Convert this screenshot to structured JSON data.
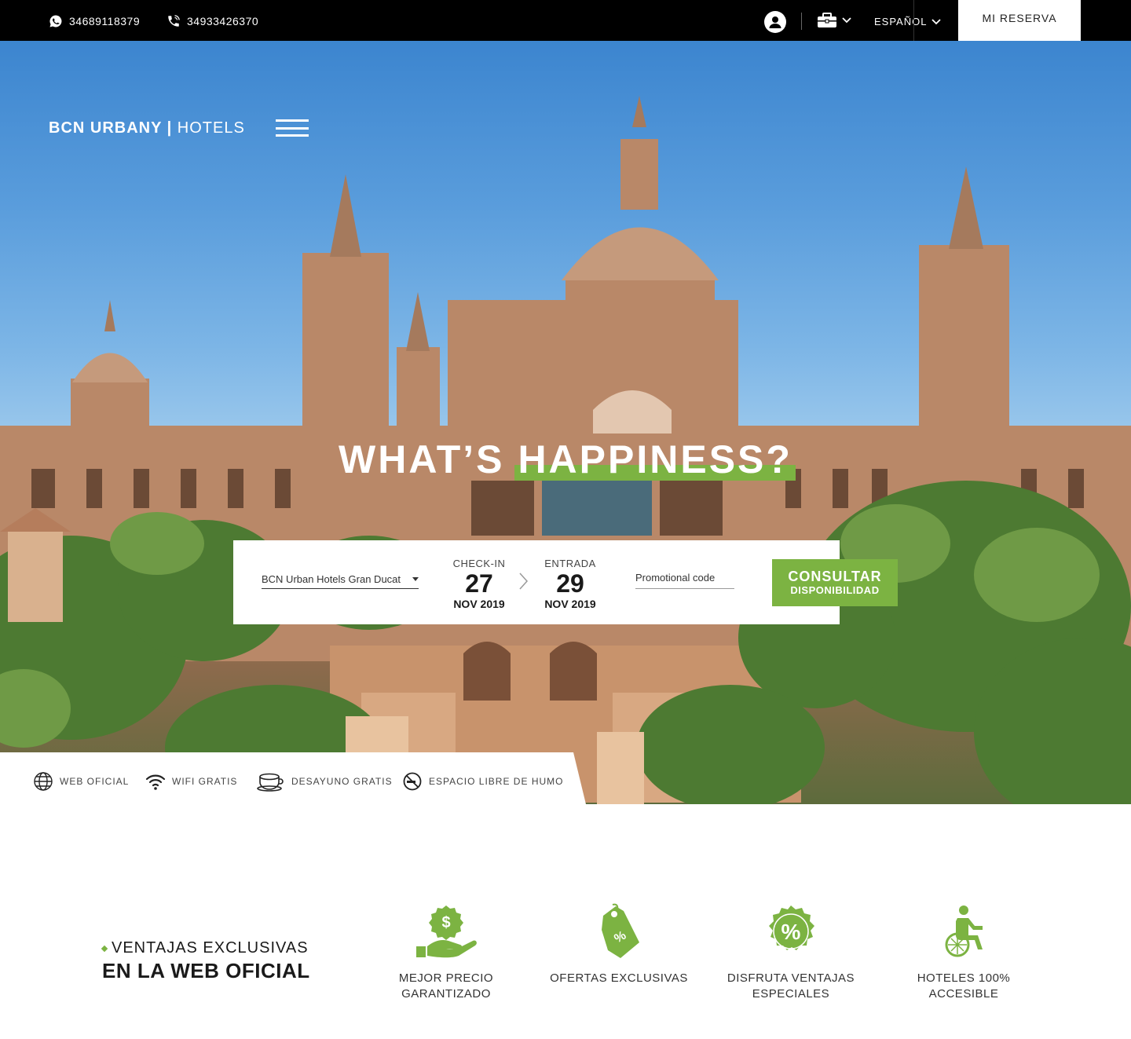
{
  "topbar": {
    "whatsapp": "34689118379",
    "phone": "34933426370",
    "language": "ESPAÑOL",
    "reserva": "MI RESERVA"
  },
  "hero": {
    "brand_bold": "BCN URBANY |",
    "brand_light": "HOTELS",
    "headline_1": "WHAT’S",
    "headline_2": "HAPPINESS?"
  },
  "booking": {
    "hotel": "BCN Urban Hotels Gran Ducat",
    "checkin_label": "CHECK-IN",
    "checkin_day": "27",
    "checkin_month": "NOV 2019",
    "checkout_label": "ENTRADA",
    "checkout_day": "29",
    "checkout_month": "NOV 2019",
    "promo_placeholder": "Promotional code",
    "submit_line1": "CONSULTAR",
    "submit_line2": "DISPONIBILIDAD"
  },
  "features": [
    {
      "icon": "globe-icon",
      "label": "WEB OFICIAL"
    },
    {
      "icon": "wifi-icon",
      "label": "WIFI GRATIS"
    },
    {
      "icon": "coffee-cup-icon",
      "label": "DESAYUNO GRATIS"
    },
    {
      "icon": "no-smoking-icon",
      "label": "ESPACIO LIBRE DE HUMO"
    }
  ],
  "advantages": {
    "title_line1": "VENTAJAS EXCLUSIVAS",
    "title_line2": "EN LA WEB OFICIAL",
    "items": [
      {
        "icon": "money-hand-icon",
        "label_1": "MEJOR PRECIO",
        "label_2": "GARANTIZADO"
      },
      {
        "icon": "discount-tag-icon",
        "label_1": "OFERTAS EXCLUSIVAS",
        "label_2": ""
      },
      {
        "icon": "percent-badge-icon",
        "label_1": "DISFRUTA VENTAJAS",
        "label_2": "ESPECIALES"
      },
      {
        "icon": "wheelchair-icon",
        "label_1": "HOTELES 100%",
        "label_2": "ACCESIBLE"
      }
    ]
  },
  "colors": {
    "accent": "#7cb342",
    "topbar": "#000000"
  }
}
